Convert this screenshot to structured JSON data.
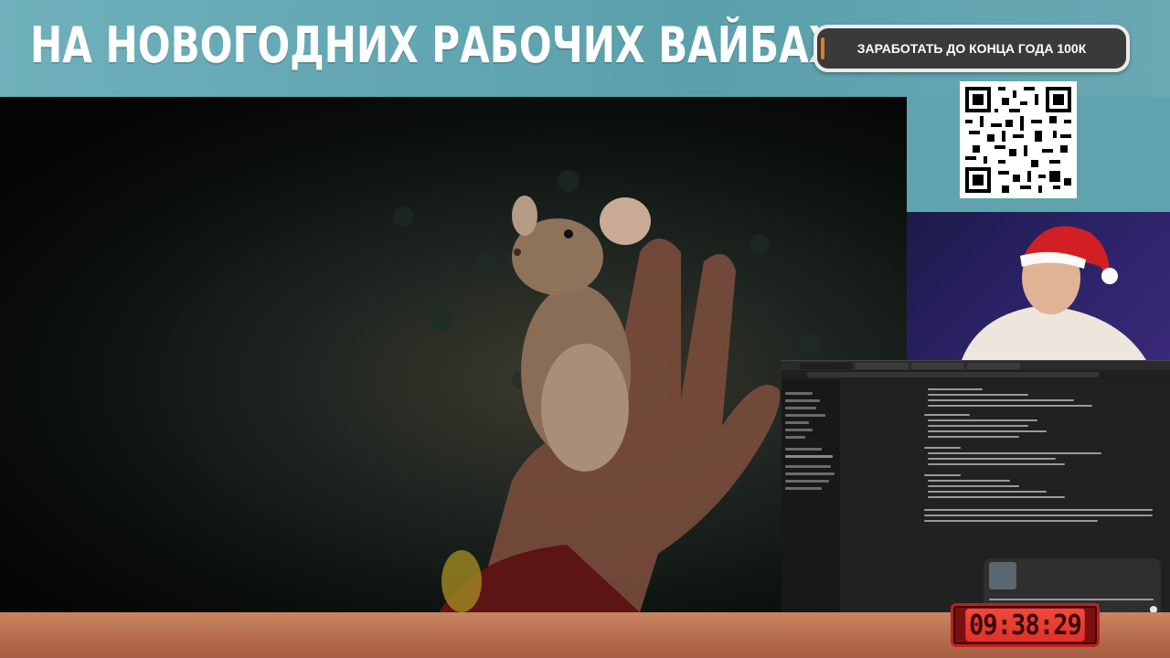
{
  "header": {
    "title": "НА НОВОГОДНИХ РАБОЧИХ ВАЙБАХ",
    "cta_label": "ЗАРАБОТАТЬ ДО КОНЦА ГОДА 100К"
  },
  "icons": [
    "qr-code-icon"
  ],
  "timer": {
    "value": "09:38:29"
  },
  "colors": {
    "header_bg": "#6fb0bb",
    "cta_bg": "#3a3a3a",
    "cta_accent": "#e07b2a",
    "timer_bg": "#e0302a",
    "floor": "#b56b4b",
    "webcam_bg": "#2b2266"
  }
}
